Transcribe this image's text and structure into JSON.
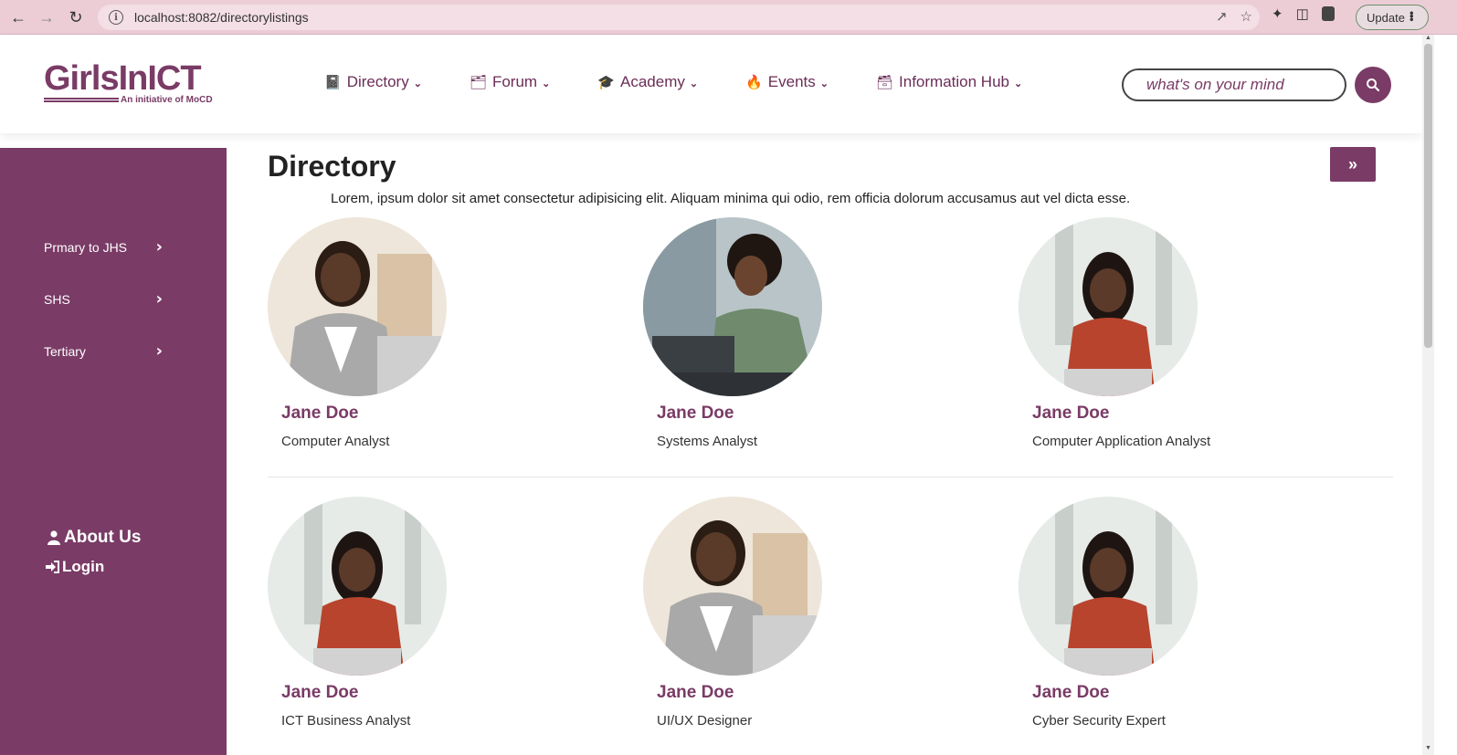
{
  "browser": {
    "url": "localhost:8082/directorylistings",
    "update_label": "Update"
  },
  "header": {
    "logo_text": "GirlsInICT",
    "logo_subtitle": "An initiative of MoCD",
    "nav": [
      {
        "label": "Directory",
        "icon": "address-book-icon"
      },
      {
        "label": "Forum",
        "icon": "folder-open-icon"
      },
      {
        "label": "Academy",
        "icon": "graduation-cap-icon"
      },
      {
        "label": "Events",
        "icon": "fire-icon"
      },
      {
        "label": "Information Hub",
        "icon": "archive-icon"
      }
    ],
    "search_placeholder": "what's on your mind"
  },
  "sidebar": {
    "items": [
      {
        "label": "Prmary to JHS"
      },
      {
        "label": "SHS"
      },
      {
        "label": "Tertiary"
      }
    ],
    "about_label": "About Us",
    "login_label": "Login"
  },
  "main": {
    "title": "Directory",
    "lead": "Lorem, ipsum dolor sit amet consectetur adipisicing elit. Aliquam minima qui odio, rem officia dolorum accusamus aut vel dicta esse.",
    "cards": [
      {
        "name": "Jane Doe",
        "role": "Computer Analyst"
      },
      {
        "name": "Jane Doe",
        "role": "Systems Analyst"
      },
      {
        "name": "Jane Doe",
        "role": "Computer Application Analyst"
      },
      {
        "name": "Jane Doe",
        "role": "ICT Business Analyst"
      },
      {
        "name": "Jane Doe",
        "role": "UI/UX Designer"
      },
      {
        "name": "Jane Doe",
        "role": "Cyber Security Expert"
      }
    ]
  },
  "colors": {
    "brand": "#7a3b66",
    "chrome": "#eccdd6"
  }
}
